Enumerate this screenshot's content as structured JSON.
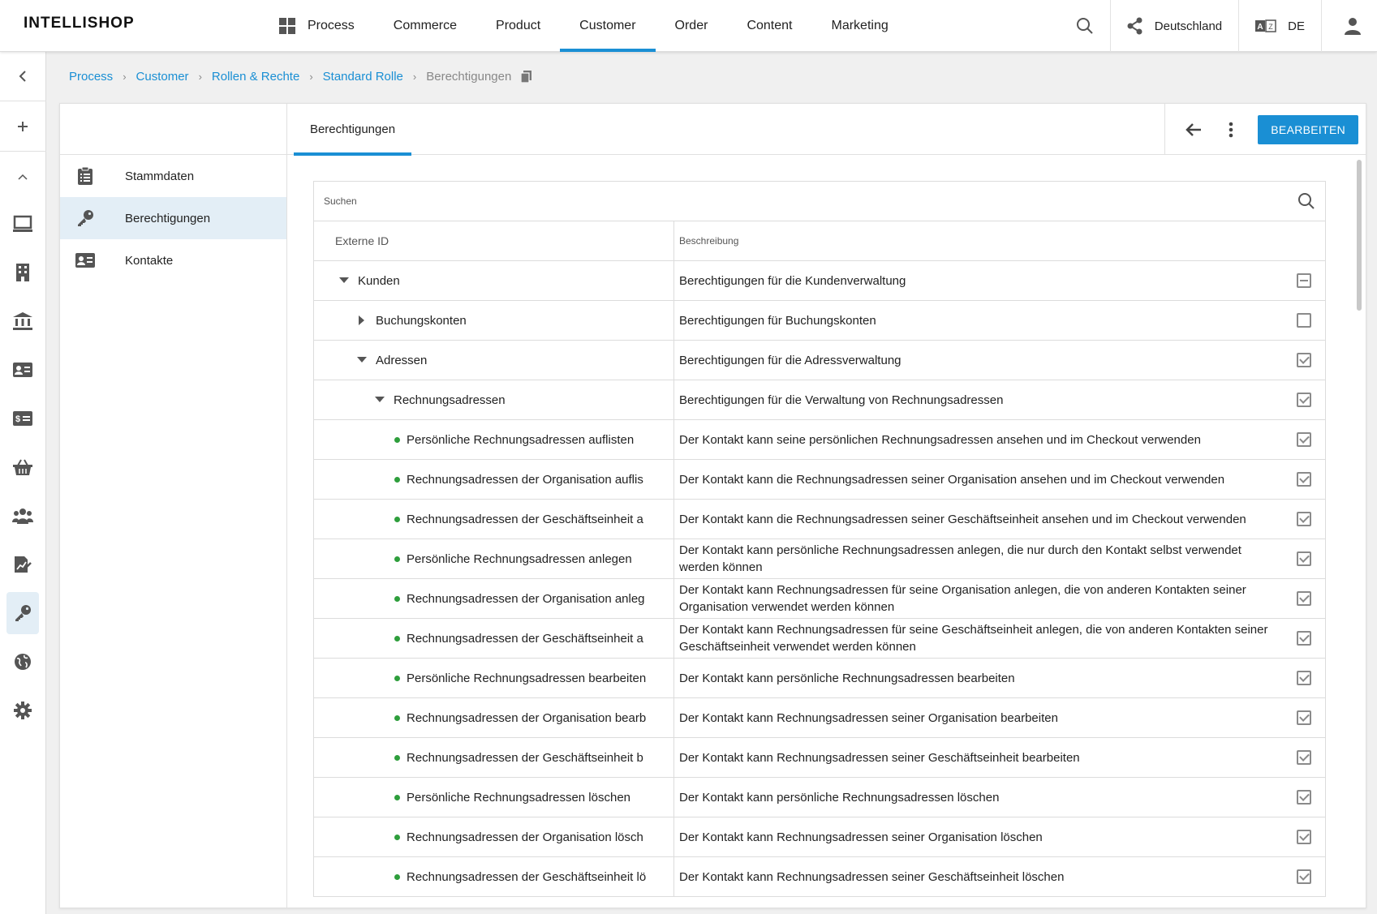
{
  "header": {
    "logo": "INTELLISHOP",
    "nav": [
      {
        "label": "Process",
        "active": false
      },
      {
        "label": "Commerce",
        "active": false
      },
      {
        "label": "Product",
        "active": false
      },
      {
        "label": "Customer",
        "active": true
      },
      {
        "label": "Order",
        "active": false
      },
      {
        "label": "Content",
        "active": false
      },
      {
        "label": "Marketing",
        "active": false
      }
    ],
    "country": "Deutschland",
    "language": "DE"
  },
  "rail": {
    "icons": [
      "chevron-left-icon",
      "plus-icon",
      "chevron-up-icon",
      "monitor-icon",
      "building-icon",
      "bank-icon",
      "contact-card-icon",
      "price-card-icon",
      "basket-icon",
      "users-icon",
      "document-chart-icon",
      "key-icon",
      "globe-icon",
      "gear-icon"
    ],
    "active": "key-icon"
  },
  "breadcrumb": {
    "items": [
      "Process",
      "Customer",
      "Rollen & Rechte",
      "Standard Rolle"
    ],
    "current": "Berechtigungen"
  },
  "sidebar": {
    "items": [
      {
        "label": "Stammdaten",
        "icon": "clipboard-icon",
        "active": false
      },
      {
        "label": "Berechtigungen",
        "icon": "key-icon",
        "active": true
      },
      {
        "label": "Kontakte",
        "icon": "contact-card-icon",
        "active": false
      }
    ]
  },
  "tabs": {
    "active_tab": "Berechtigungen",
    "edit_button": "BEARBEITEN"
  },
  "table": {
    "search_placeholder": "Suchen",
    "col_id": "Externe ID",
    "col_desc": "Beschreibung",
    "rows": [
      {
        "id": "Kunden",
        "desc": "Berechtigungen für die Kundenverwaltung",
        "level": 0,
        "toggle": "expanded",
        "state": "indeterminate"
      },
      {
        "id": "Buchungskonten",
        "desc": "Berechtigungen für Buchungskonten",
        "level": 1,
        "toggle": "collapsed",
        "state": "unchecked"
      },
      {
        "id": "Adressen",
        "desc": "Berechtigungen für die Adressverwaltung",
        "level": 1,
        "toggle": "expanded",
        "state": "checked"
      },
      {
        "id": "Rechnungsadressen",
        "desc": "Berechtigungen für die Verwaltung von Rechnungsadressen",
        "level": 2,
        "toggle": "expanded",
        "state": "checked"
      },
      {
        "id": "Persönliche Rechnungsadressen auflisten",
        "desc": "Der Kontakt kann seine persönlichen Rechnungsadressen ansehen und im Checkout verwenden",
        "level": 3,
        "toggle": "leaf",
        "state": "checked"
      },
      {
        "id": "Rechnungsadressen der Organisation auflis",
        "desc": "Der Kontakt kann die Rechnungsadressen seiner Organisation ansehen und im Checkout verwenden",
        "level": 3,
        "toggle": "leaf",
        "state": "checked"
      },
      {
        "id": "Rechnungsadressen der Geschäftseinheit a",
        "desc": "Der Kontakt kann die Rechnungsadressen seiner Geschäftseinheit ansehen und im Checkout verwenden",
        "level": 3,
        "toggle": "leaf",
        "state": "checked"
      },
      {
        "id": "Persönliche Rechnungsadressen anlegen",
        "desc": "Der Kontakt kann persönliche Rechnungsadressen anlegen, die nur durch den Kontakt selbst verwendet werden können",
        "level": 3,
        "toggle": "leaf",
        "state": "checked"
      },
      {
        "id": "Rechnungsadressen der Organisation anleg",
        "desc": "Der Kontakt kann Rechnungsadressen für seine Organisation anlegen, die von anderen Kontakten seiner Organisation verwendet werden können",
        "level": 3,
        "toggle": "leaf",
        "state": "checked"
      },
      {
        "id": "Rechnungsadressen der Geschäftseinheit a",
        "desc": "Der Kontakt kann Rechnungsadressen für seine Geschäftseinheit anlegen, die von anderen Kontakten seiner Geschäftseinheit verwendet werden können",
        "level": 3,
        "toggle": "leaf",
        "state": "checked"
      },
      {
        "id": "Persönliche Rechnungsadressen bearbeiten",
        "desc": "Der Kontakt kann persönliche Rechnungsadressen bearbeiten",
        "level": 3,
        "toggle": "leaf",
        "state": "checked"
      },
      {
        "id": "Rechnungsadressen der Organisation bearb",
        "desc": "Der Kontakt kann Rechnungsadressen seiner Organisation bearbeiten",
        "level": 3,
        "toggle": "leaf",
        "state": "checked"
      },
      {
        "id": "Rechnungsadressen der Geschäftseinheit b",
        "desc": "Der Kontakt kann Rechnungsadressen seiner Geschäftseinheit bearbeiten",
        "level": 3,
        "toggle": "leaf",
        "state": "checked"
      },
      {
        "id": "Persönliche Rechnungsadressen löschen",
        "desc": "Der Kontakt kann persönliche Rechnungsadressen löschen",
        "level": 3,
        "toggle": "leaf",
        "state": "checked"
      },
      {
        "id": "Rechnungsadressen der Organisation lösch",
        "desc": "Der Kontakt kann Rechnungsadressen seiner Organisation löschen",
        "level": 3,
        "toggle": "leaf",
        "state": "checked"
      },
      {
        "id": "Rechnungsadressen der Geschäftseinheit lö",
        "desc": "Der Kontakt kann Rechnungsadressen seiner Geschäftseinheit löschen",
        "level": 3,
        "toggle": "leaf",
        "state": "checked"
      }
    ]
  },
  "colors": {
    "accent": "#1a8fd4",
    "active_bg": "#e3eef6",
    "leaf_dot": "#2e9e3c"
  }
}
